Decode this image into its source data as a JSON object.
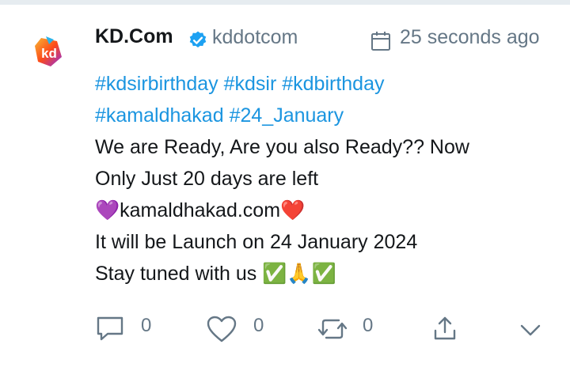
{
  "tweet": {
    "author_name": "KD.Com",
    "handle": "kddotcom",
    "time": "25 seconds ago",
    "hashtags_line1": [
      "#kdsirbirthday",
      "#kdsir",
      "#kdbirthday"
    ],
    "hashtags_line2": [
      "#kamaldhakad",
      "#24_January"
    ],
    "text_line1": "We are Ready, Are you also Ready?? Now",
    "text_line2": "Only Just 20 days are left",
    "text_line3_prefix": "💜",
    "text_line3_domain": "kamaldhakad.com",
    "text_line3_suffix": "❤️",
    "text_line4": "It will be Launch on 24 January 2024",
    "text_line5": "Stay tuned with us",
    "text_line5_emojis": "✅🙏✅"
  },
  "actions": {
    "reply_count": "0",
    "like_count": "0",
    "retweet_count": "0"
  },
  "icons": {
    "verified": "verified-badge-icon",
    "calendar": "calendar-icon",
    "reply": "reply-icon",
    "like": "heart-icon",
    "retweet": "retweet-icon",
    "share": "share-icon",
    "more": "chevron-down-icon"
  },
  "colors": {
    "link": "#1b95e0",
    "muted": "#657786",
    "verified": "#1da1f2"
  }
}
